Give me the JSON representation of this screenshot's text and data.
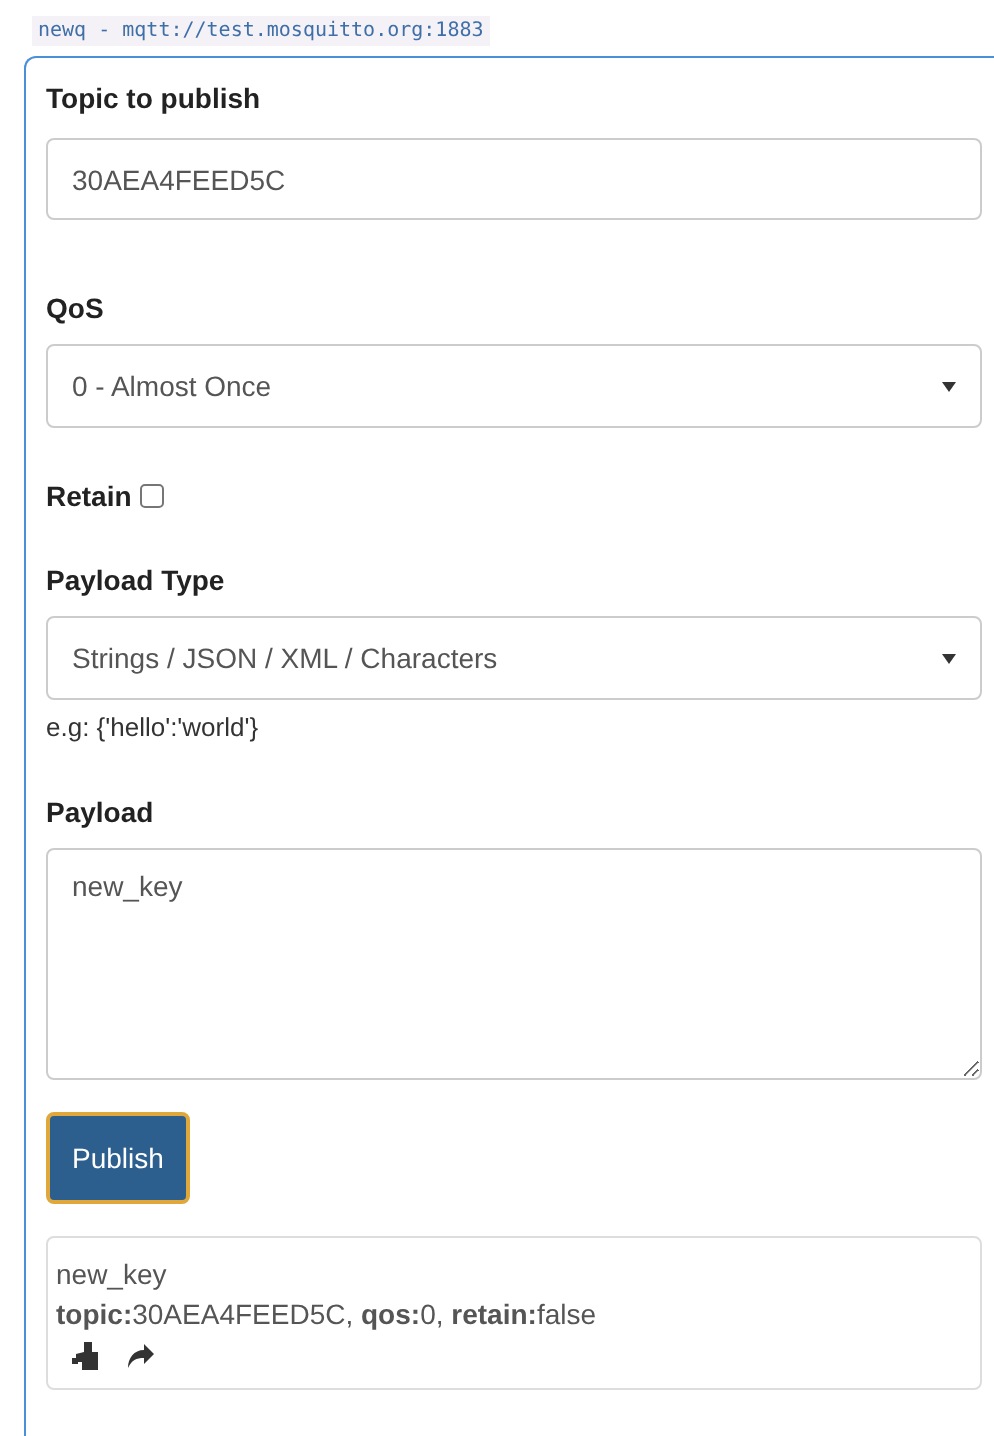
{
  "connection_tab": {
    "label": "newq - mqtt://test.mosquitto.org:1883"
  },
  "topic": {
    "label": "Topic to publish",
    "value": "30AEA4FEED5C"
  },
  "qos": {
    "label": "QoS",
    "value": "0 - Almost Once"
  },
  "retain": {
    "label": "Retain",
    "checked": false
  },
  "payload_type": {
    "label": "Payload Type",
    "value": "Strings / JSON / XML / Characters",
    "hint": "e.g: {'hello':'world'}"
  },
  "payload": {
    "label": "Payload",
    "value": "new_key"
  },
  "publish_button": {
    "label": "Publish"
  },
  "messages": [
    {
      "payload": "new_key",
      "meta": "**topic:**30AEA4FEED5C, **qos:**0, **retain:**false"
    }
  ]
}
